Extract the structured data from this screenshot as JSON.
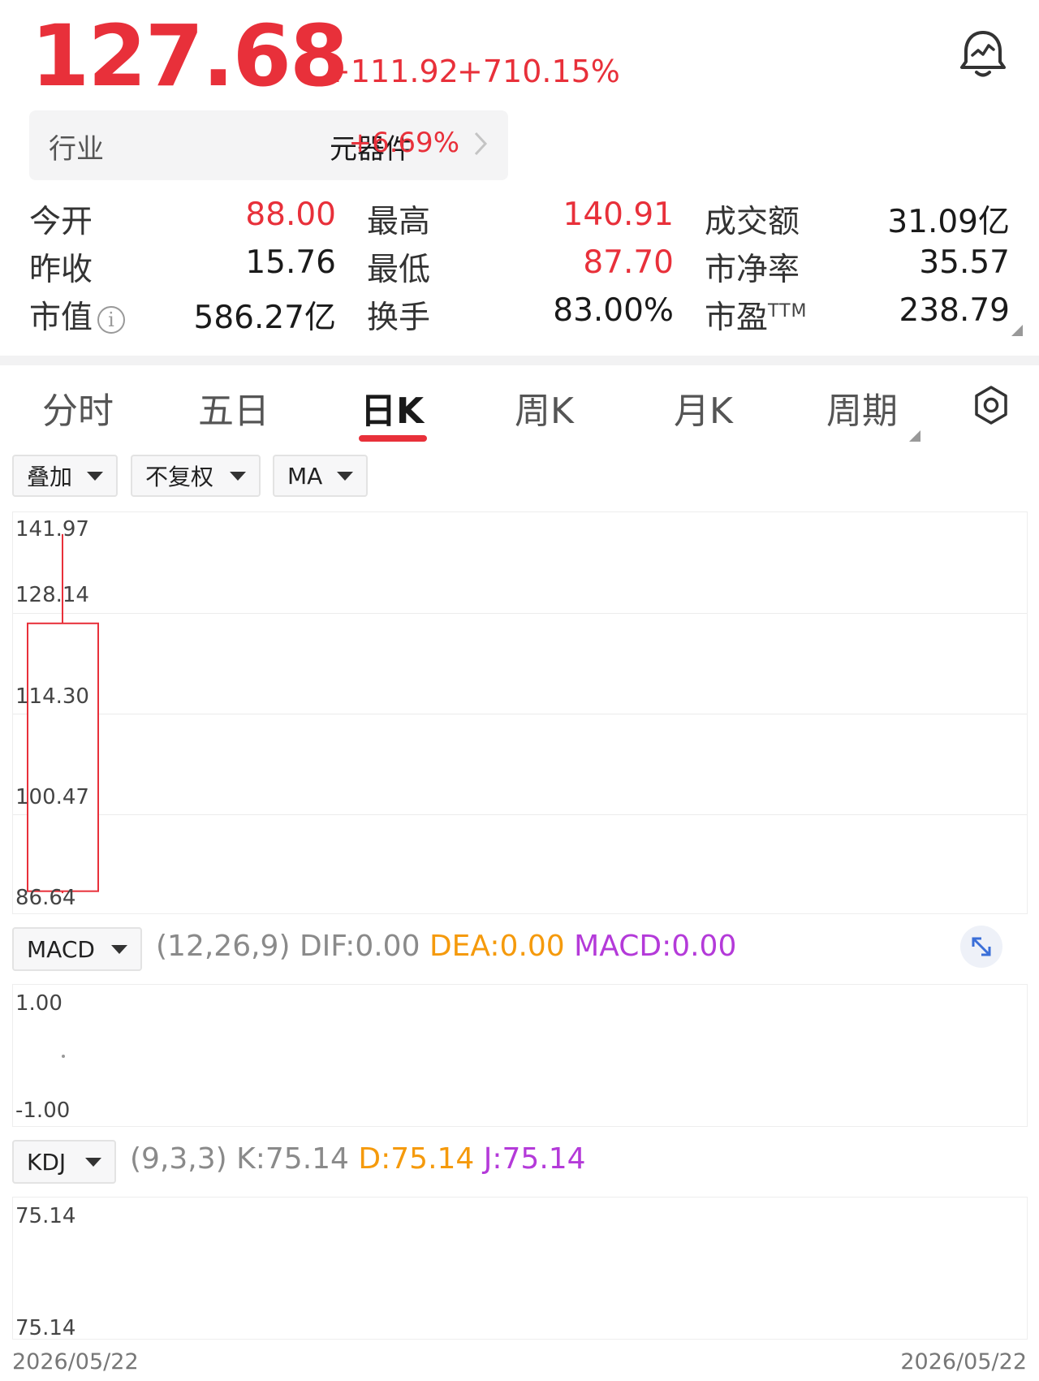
{
  "quote": {
    "price": "127.68",
    "change": "+111.92",
    "change_pct": "+710.15%"
  },
  "industry": {
    "label": "行业",
    "name": "元器件",
    "change_pct": "+6.69%"
  },
  "stats": {
    "col1": [
      {
        "label": "今开",
        "value": "88.00",
        "color": "#e8303a"
      },
      {
        "label": "昨收",
        "value": "15.76",
        "color": "#1a1a1a"
      },
      {
        "label": "市值",
        "value": "586.27亿",
        "color": "#1a1a1a"
      }
    ],
    "col2": [
      {
        "label": "最高",
        "value": "140.91",
        "color": "#e8303a"
      },
      {
        "label": "最低",
        "value": "87.70",
        "color": "#e8303a"
      },
      {
        "label": "换手",
        "value": "83.00%",
        "color": "#1a1a1a"
      }
    ],
    "col3": [
      {
        "label": "成交额",
        "value": "31.09亿",
        "color": "#1a1a1a"
      },
      {
        "label": "市净率",
        "value": "35.57",
        "color": "#1a1a1a"
      },
      {
        "label": "市盈",
        "superscript": "TTM",
        "value": "238.79",
        "color": "#1a1a1a"
      }
    ]
  },
  "tabs": [
    "分时",
    "五日",
    "日K",
    "周K",
    "月K",
    "周期"
  ],
  "active_tab": "日K",
  "toolbar": {
    "overlay": "叠加",
    "adjust": "不复权",
    "ma": "MA"
  },
  "kline": {
    "y_labels": [
      "141.97",
      "128.14",
      "114.30",
      "100.47",
      "86.64"
    ],
    "ylim": [
      86.64,
      141.97
    ],
    "candle": {
      "open": 88.0,
      "close": 127.68,
      "high": 140.91,
      "low": 87.7
    },
    "up_color": "#e8303a"
  },
  "macd": {
    "name": "MACD",
    "params": "(12,26,9)",
    "dif": "DIF:0.00",
    "dea": "DEA:0.00",
    "macd": "MACD:0.00",
    "y_labels": [
      "1.00",
      "-1.00"
    ]
  },
  "kdj": {
    "name": "KDJ",
    "params": "(9,3,3)",
    "k": "K:75.14",
    "d": "D:75.14",
    "j": "J:75.14",
    "y_labels": [
      "75.14",
      "75.14"
    ]
  },
  "dates": {
    "start": "2026/05/22",
    "end": "2026/05/22"
  },
  "colors": {
    "up": "#e8303a",
    "dea": "#f59a0c",
    "macd": "#b43ad9"
  }
}
